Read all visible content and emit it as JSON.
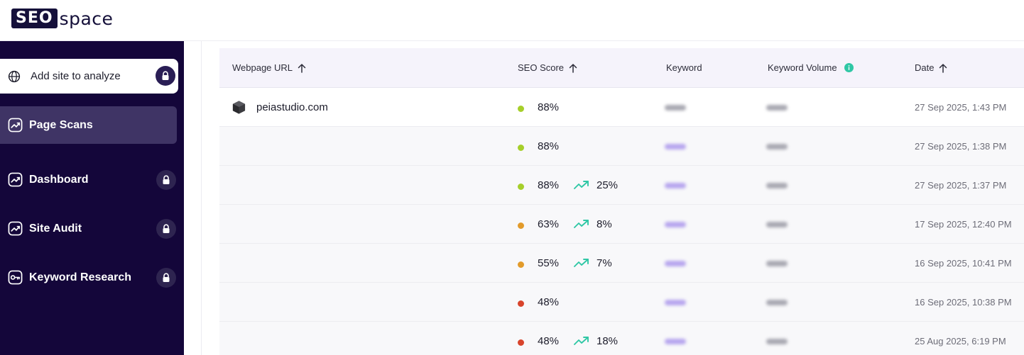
{
  "brand": {
    "logo_left": "SEO",
    "logo_right": "space",
    "accent": "#14063a"
  },
  "sidebar": {
    "add_site": {
      "label": "Add site to analyze",
      "icon": "globe-icon",
      "locked": true
    },
    "items": [
      {
        "label": "Page Scans",
        "icon": "chart-icon",
        "active": true,
        "locked": false
      },
      {
        "label": "Dashboard",
        "icon": "chart-icon",
        "active": false,
        "locked": true
      },
      {
        "label": "Site Audit",
        "icon": "chart-icon",
        "active": false,
        "locked": true
      },
      {
        "label": "Keyword Research",
        "icon": "key-icon",
        "active": false,
        "locked": true
      }
    ]
  },
  "table": {
    "columns": {
      "url": "Webpage URL",
      "score": "SEO Score",
      "keyword": "Keyword",
      "volume": "Keyword Volume",
      "date": "Date"
    },
    "rows": [
      {
        "url": "peiastudio.com",
        "score": "88%",
        "status_color": "#a6cf2a",
        "change": "",
        "keyword_style": "gray",
        "date": "27 Sep 2025, 1:43 PM"
      },
      {
        "url": "",
        "score": "88%",
        "status_color": "#a6cf2a",
        "change": "",
        "keyword_style": "purple",
        "date": "27 Sep 2025, 1:38 PM"
      },
      {
        "url": "",
        "score": "88%",
        "status_color": "#a6cf2a",
        "change": "25%",
        "keyword_style": "purple",
        "date": "27 Sep 2025, 1:37 PM"
      },
      {
        "url": "",
        "score": "63%",
        "status_color": "#e29b2b",
        "change": "8%",
        "keyword_style": "purple",
        "date": "17 Sep 2025, 12:40 PM"
      },
      {
        "url": "",
        "score": "55%",
        "status_color": "#e29b2b",
        "change": "7%",
        "keyword_style": "purple",
        "date": "16 Sep 2025, 10:41 PM"
      },
      {
        "url": "",
        "score": "48%",
        "status_color": "#d8442c",
        "change": "",
        "keyword_style": "purple",
        "date": "16 Sep 2025, 10:38 PM"
      },
      {
        "url": "",
        "score": "48%",
        "status_color": "#d8442c",
        "change": "18%",
        "keyword_style": "purple",
        "date": "25 Aug 2025, 6:19 PM"
      }
    ]
  }
}
